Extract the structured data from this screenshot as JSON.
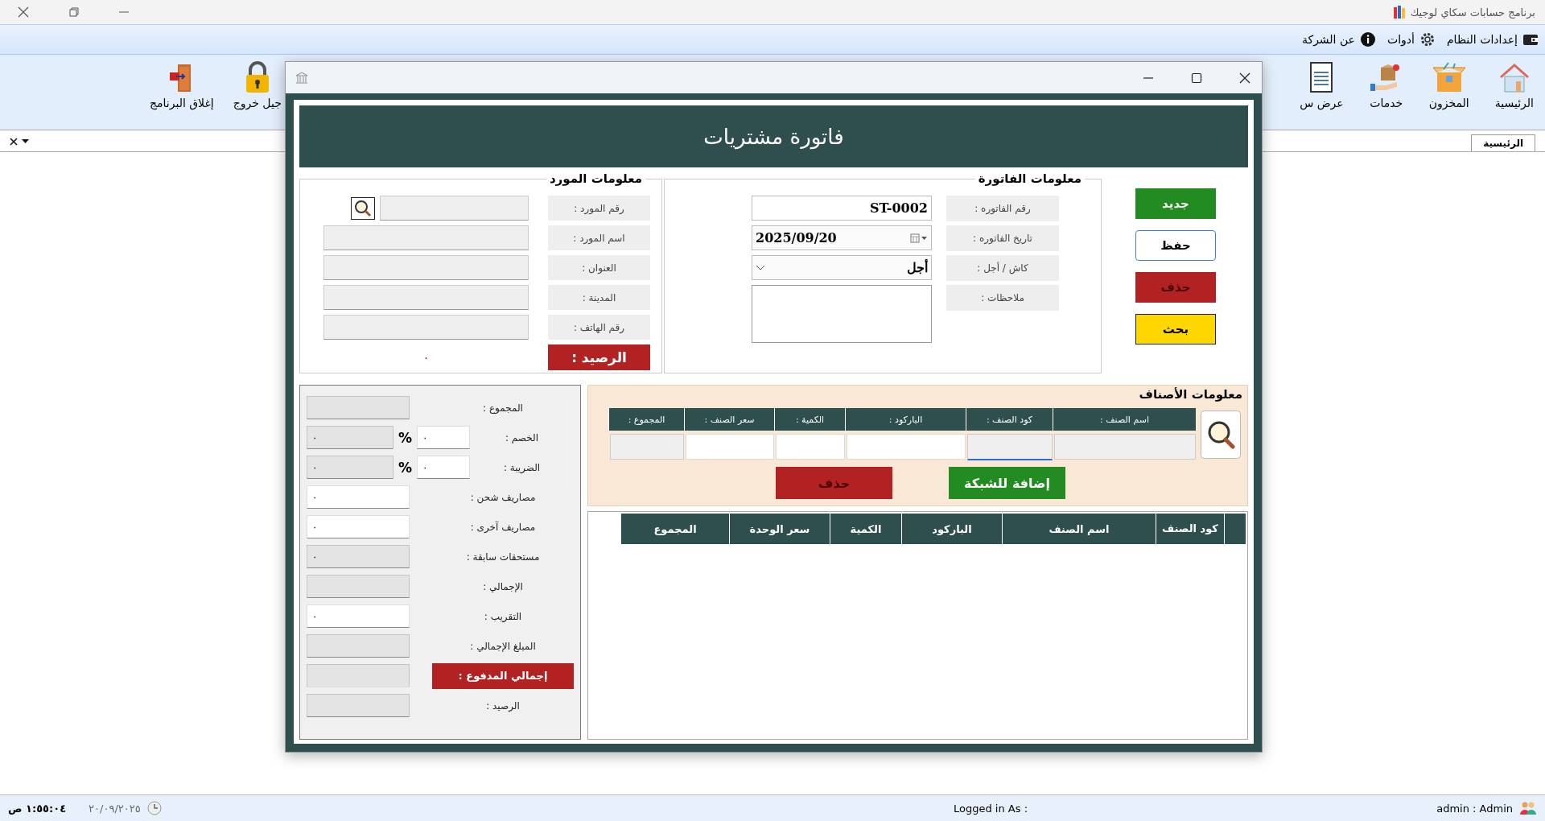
{
  "app_title": "برنامج حسابات سكاي لوجيك",
  "menu": [
    {
      "label": "إعدادات النظام"
    },
    {
      "label": "أدوات"
    },
    {
      "label": "عن الشركة"
    }
  ],
  "toolbar_right": [
    {
      "label": "الرئيسية"
    },
    {
      "label": "المخزون"
    },
    {
      "label": "خدمات"
    },
    {
      "label": "عرض س"
    }
  ],
  "toolbar_left": [
    {
      "label": "جيل خروج"
    },
    {
      "label": "إغلاق البرنامج"
    }
  ],
  "tabs": [
    {
      "label": "الرئيسية",
      "selected": true
    }
  ],
  "dialog": {
    "title": "فاتورة مشتريات",
    "actions": [
      {
        "label": "جديد",
        "kind": "new"
      },
      {
        "label": "حفظ",
        "kind": "save"
      },
      {
        "label": "حذف",
        "kind": "delete"
      },
      {
        "label": "بحث",
        "kind": "search"
      }
    ],
    "invoice_info": {
      "title": "معلومات الفاتورة",
      "fields": [
        {
          "label": "رقم الفاتوره :",
          "kind": "text",
          "value": "ST-0002"
        },
        {
          "label": "تاريخ الفاتوره :",
          "kind": "date",
          "value": "2025/09/20"
        },
        {
          "label": "كاش / أجل :",
          "kind": "select",
          "value": "أجل"
        },
        {
          "label": "ملاحظات :",
          "kind": "memo"
        }
      ]
    },
    "supplier_info": {
      "title": "معلومات المورد",
      "fields": [
        {
          "label": "رقم المورد :",
          "kind": "lookup"
        },
        {
          "label": "اسم المورد :",
          "kind": "text"
        },
        {
          "label": "العنوان :",
          "kind": "text"
        },
        {
          "label": "المدينة :",
          "kind": "text"
        },
        {
          "label": "رقم الهاتف :",
          "kind": "text"
        }
      ],
      "balance_label": "الرصيد :",
      "balance_value": "٠"
    },
    "items_info": {
      "title": "معلومات الأصناف",
      "columns": [
        {
          "label": "اسم الصنف :",
          "readonly": true,
          "focused": false
        },
        {
          "label": "كود الصنف :",
          "readonly": true,
          "focused": true
        },
        {
          "label": "الباركود :",
          "readonly": false,
          "focused": false
        },
        {
          "label": "الكمية :",
          "readonly": false,
          "focused": false
        },
        {
          "label": "سعر الصنف :",
          "readonly": false,
          "focused": false
        },
        {
          "label": "المجموع :",
          "readonly": true,
          "focused": false
        }
      ],
      "add_button": "إضافة للشبكة",
      "delete_button": "حذف"
    },
    "grid": {
      "columns": [
        "كود الصنف",
        "اسم الصنف",
        "الباركود",
        "الكمية",
        "سعر الوحدة",
        "المجموع"
      ]
    },
    "totals": [
      {
        "label": "المجموع :",
        "kind": "field",
        "readonly": true
      },
      {
        "label": "الخصم :",
        "kind": "percent",
        "input": "٠",
        "unit": "%",
        "value": "٠",
        "readonly": true
      },
      {
        "label": "الضريبة :",
        "kind": "percent",
        "input": "٠",
        "unit": "%",
        "value": "٠",
        "readonly": true
      },
      {
        "label": "مصاريف شحن :",
        "kind": "field",
        "value": "٠",
        "readonly": false
      },
      {
        "label": "مصاريف آخرى :",
        "kind": "field",
        "value": "٠",
        "readonly": false
      },
      {
        "label": "مستحقات سابقة :",
        "kind": "field",
        "value": "٠",
        "readonly": true
      },
      {
        "label": "الإجمالي :",
        "kind": "field",
        "readonly": true
      },
      {
        "label": "التقريب :",
        "kind": "field",
        "value": "٠",
        "readonly": false
      },
      {
        "label": "المبلغ الإجمالي :",
        "kind": "field",
        "readonly": true
      },
      {
        "label": "إجمالي المدفوع :",
        "kind": "highlight",
        "readonly": true
      },
      {
        "label": "الرصيد :",
        "kind": "field",
        "readonly": true
      }
    ]
  },
  "status_bar": {
    "time": "١:٥٥:٠٤ ص",
    "date": "٢٠/٠٩/٢٠٢٥",
    "logged_in": "Logged in As :",
    "user": "admin  :  Admin"
  }
}
